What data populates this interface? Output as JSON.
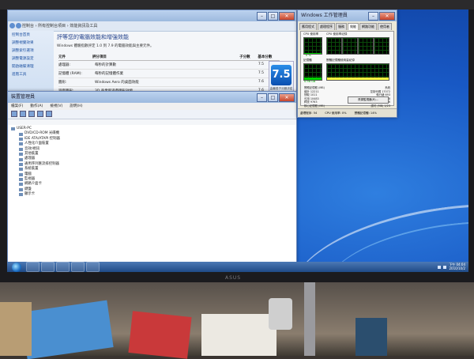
{
  "perf_window": {
    "title": "",
    "address": "控制台 › 所有控制台項目 › 效能資訊及工具",
    "side_links": [
      "控制台首頁",
      "調整視覺效果",
      "調整索引選項",
      "調整電源設定",
      "開啟磁碟清理",
      "進階工具"
    ],
    "heading": "評等您的電腦效能和增強效能",
    "subtext": "Windows 體驗指數評定 1.0 到 7.9 的電腦效能與主要元件。",
    "table_headers": [
      "元件",
      "評分項目",
      "子分數",
      "基本分數"
    ],
    "rows": [
      {
        "component": "處理器:",
        "desc": "每秒的計算數",
        "score": "7.5"
      },
      {
        "component": "記憶體 (RAM):",
        "desc": "每秒的記憶體作業",
        "score": "7.5"
      },
      {
        "component": "圖形:",
        "desc": "Windows Aero 的桌面效能",
        "score": "7.6"
      },
      {
        "component": "遊戲圖形:",
        "desc": "3D 商業和遊戲圖形效能",
        "score": "7.6"
      },
      {
        "component": "主硬碟:",
        "desc": "磁碟資料傳輸速率",
        "score": "7.9"
      }
    ],
    "base_score": "7.5",
    "base_score_caption": "由最低子分數決定"
  },
  "devmgr": {
    "title": "裝置管理員",
    "menu": [
      "檔案(F)",
      "動作(A)",
      "檢視(V)",
      "說明(H)"
    ],
    "root": "USER-PC",
    "nodes": [
      "DVD/CD-ROM 光碟機",
      "IDE ATA/ATAPI 控制器",
      "人性化介面裝置",
      "音效/視訊",
      "其他裝置",
      "處理器",
      "通用序列匯流排控制器",
      "系統裝置",
      "電腦",
      "監視器",
      "網路介面卡",
      "鍵盤",
      "顯示卡"
    ]
  },
  "taskmgr": {
    "title": "Windows 工作管理員",
    "tabs": [
      "應用程式",
      "處理程序",
      "服務",
      "效能",
      "網路功能",
      "使用者"
    ],
    "cpu_label": "CPU 使用率",
    "cpu_history_label": "CPU 使用率紀錄",
    "cpu_value": "0 %",
    "mem_label": "記憶體",
    "mem_history_label": "實體記憶體使用量紀錄",
    "mem_value": "0.98 GB",
    "stats": [
      [
        "實體記憶體 (MB)",
        "系統"
      ],
      [
        "總計 12211",
        "控制代碼 17072"
      ],
      [
        "快取 1011",
        "執行緒 693"
      ],
      [
        "可用 10483",
        "處理程序 48"
      ],
      [
        "釋放 9763",
        "存留時間 0:00:09:36"
      ],
      [
        "核心記憶體 (MB)",
        "認可 (MB) 1/23"
      ],
      [
        "已分頁 136",
        ""
      ],
      [
        "非分頁 51",
        ""
      ]
    ],
    "resource_button": "資源監視器(R)...",
    "status": [
      "處理程序: 54",
      "CPU 使用率: 0%",
      "實體記憶體: 14%"
    ]
  },
  "taskbar": {
    "time": "下午 04:04",
    "date": "2010/10/2"
  },
  "brand": "ASUS",
  "colors": {
    "desktop": "#1858c4",
    "taskbar": "#2a5898",
    "score": "#0a4fb0"
  }
}
